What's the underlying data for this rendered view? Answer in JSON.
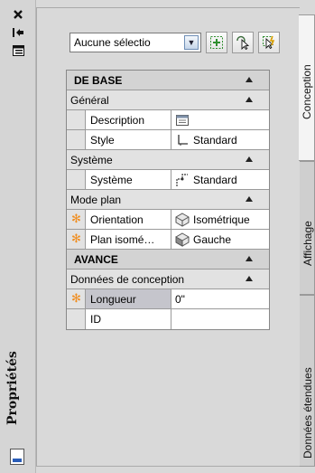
{
  "palette": {
    "panel": "#d9d9d9",
    "category": "#d3d3d3",
    "selected_row": "#c5c5cc",
    "star": "#f08c1c",
    "tab_active": "#f4f4f4"
  },
  "strip": {
    "close_icon": "close-icon",
    "autohide_icon": "autohide-icon",
    "menu_icon": "properties-menu-icon",
    "title": "Propriétés"
  },
  "toolbar": {
    "selection": "Aucune sélectio",
    "buttons": [
      "toggle-pickadd-icon",
      "select-objects-icon",
      "quick-select-icon"
    ]
  },
  "grid": {
    "de_base": "DE BASE",
    "general": "Général",
    "description_label": "Description",
    "description_value": "",
    "style_label": "Style",
    "style_value": "Standard",
    "systeme_group": "Système",
    "systeme_label": "Système",
    "systeme_value": "Standard",
    "mode_plan": "Mode plan",
    "orientation_label": "Orientation",
    "orientation_value": "Isométrique",
    "plan_iso_label": "Plan isomé…",
    "plan_iso_value": "Gauche",
    "avance": "AVANCE",
    "donnees_conception": "Données de conception",
    "longueur_label": "Longueur",
    "longueur_value": "0\"",
    "id_label": "ID",
    "id_value": ""
  },
  "tabs": [
    "Conception",
    "Affichage",
    "Données étendues"
  ]
}
